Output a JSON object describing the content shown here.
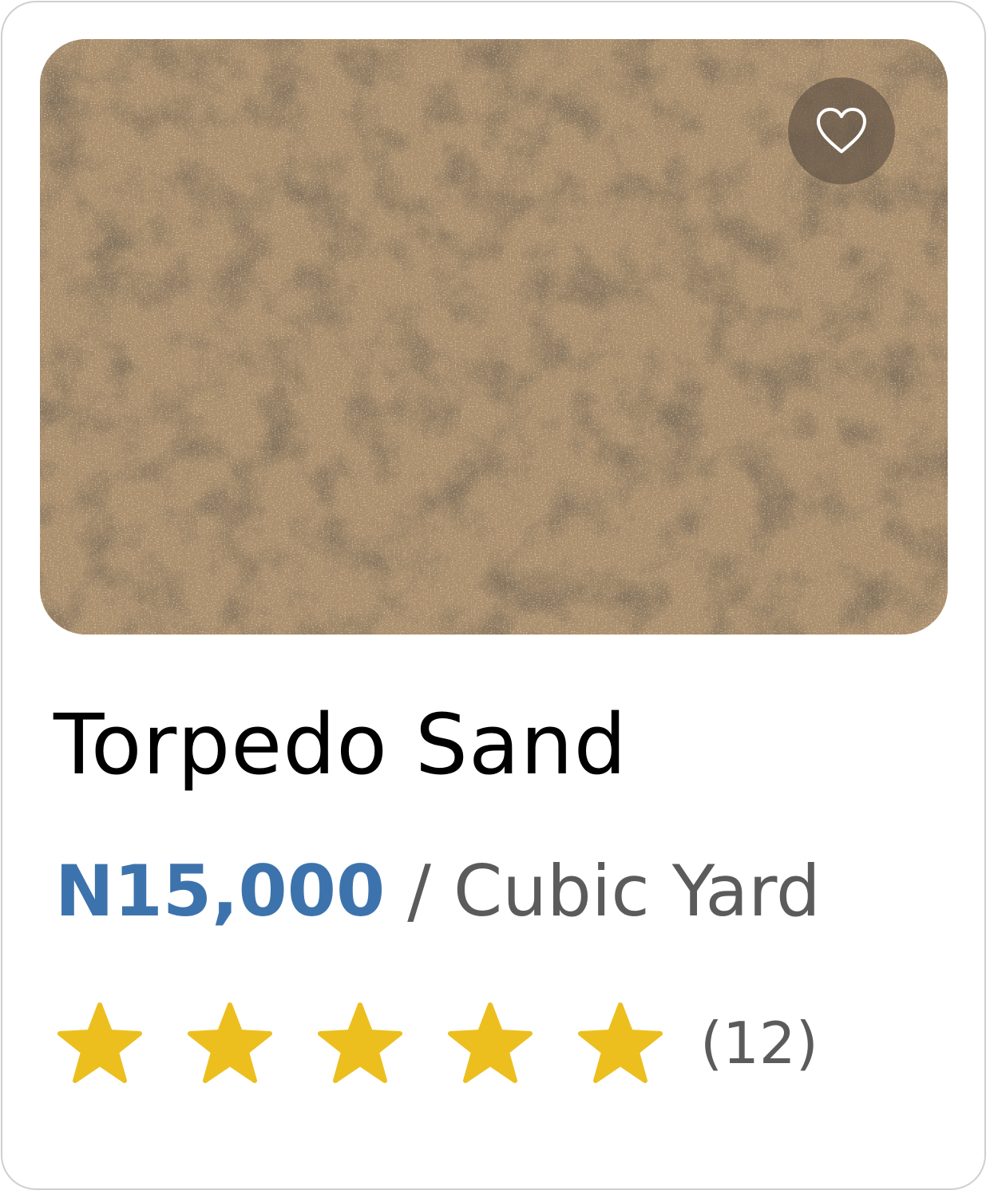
{
  "product": {
    "image_alt": "sand texture photo",
    "title": "Torpedo Sand",
    "price": "N15,000",
    "price_separator": " / ",
    "unit": "Cubic Yard",
    "rating": 5,
    "rating_max": 5,
    "review_count_label": "(12)"
  },
  "icons": {
    "favorite": "heart-outline-icon",
    "star": "star-filled-icon"
  },
  "colors": {
    "price": "#3d73ac",
    "star": "#ecbf1f",
    "muted_text": "#5b5b5b",
    "border": "#cfcfcf"
  }
}
